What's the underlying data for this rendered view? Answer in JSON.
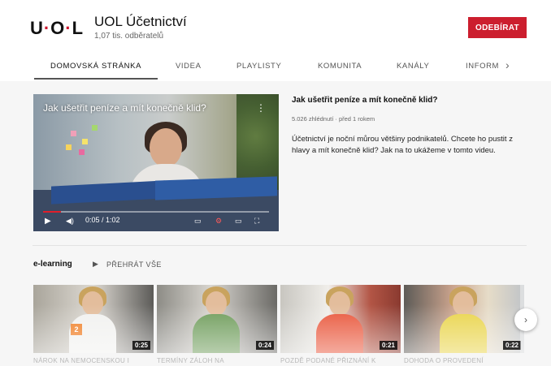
{
  "channel": {
    "logo_text": "UOL",
    "name": "UOL Účetnictví",
    "subscribers": "1,07 tis. odběratelů",
    "subscribe_label": "ODEBÍRAT",
    "accent": "#cc1e2e"
  },
  "tabs": [
    {
      "label": "DOMOVSKÁ STRÁNKA",
      "active": true
    },
    {
      "label": "VIDEA"
    },
    {
      "label": "PLAYLISTY"
    },
    {
      "label": "KOMUNITA"
    },
    {
      "label": "KANÁLY"
    },
    {
      "label": "INFORM"
    }
  ],
  "tabs_next_icon": "chevron-right-icon",
  "featured_video": {
    "overlay_title": "Jak ušetřit peníze a mít konečně klid?",
    "time": "0:05 / 1:02",
    "progress": 0.08,
    "title": "Jak ušetřit peníze a mít konečně klid?",
    "meta": "5.026 zhlédnutí · před 1 rokem",
    "description": "Účetnictví je noční můrou většiny podnikatelů. Chcete ho pustit z hlavy a mít konečně klid? Jak na to ukážeme v tomto videu."
  },
  "playlist": {
    "title": "e-learning",
    "play_all": "PŘEHRÁT VŠE",
    "items": [
      {
        "label": "NÁROK NA NEMOCENSKOU I",
        "duration": "0:25",
        "badge": "2"
      },
      {
        "label": "TERMÍNY ZÁLOH NA",
        "duration": "0:24"
      },
      {
        "label": "POZDĚ PODANÉ PŘIZNÁNÍ K",
        "duration": "0:21"
      },
      {
        "label": "DOHODA O PROVEDENÍ",
        "duration": "0:22"
      }
    ]
  }
}
